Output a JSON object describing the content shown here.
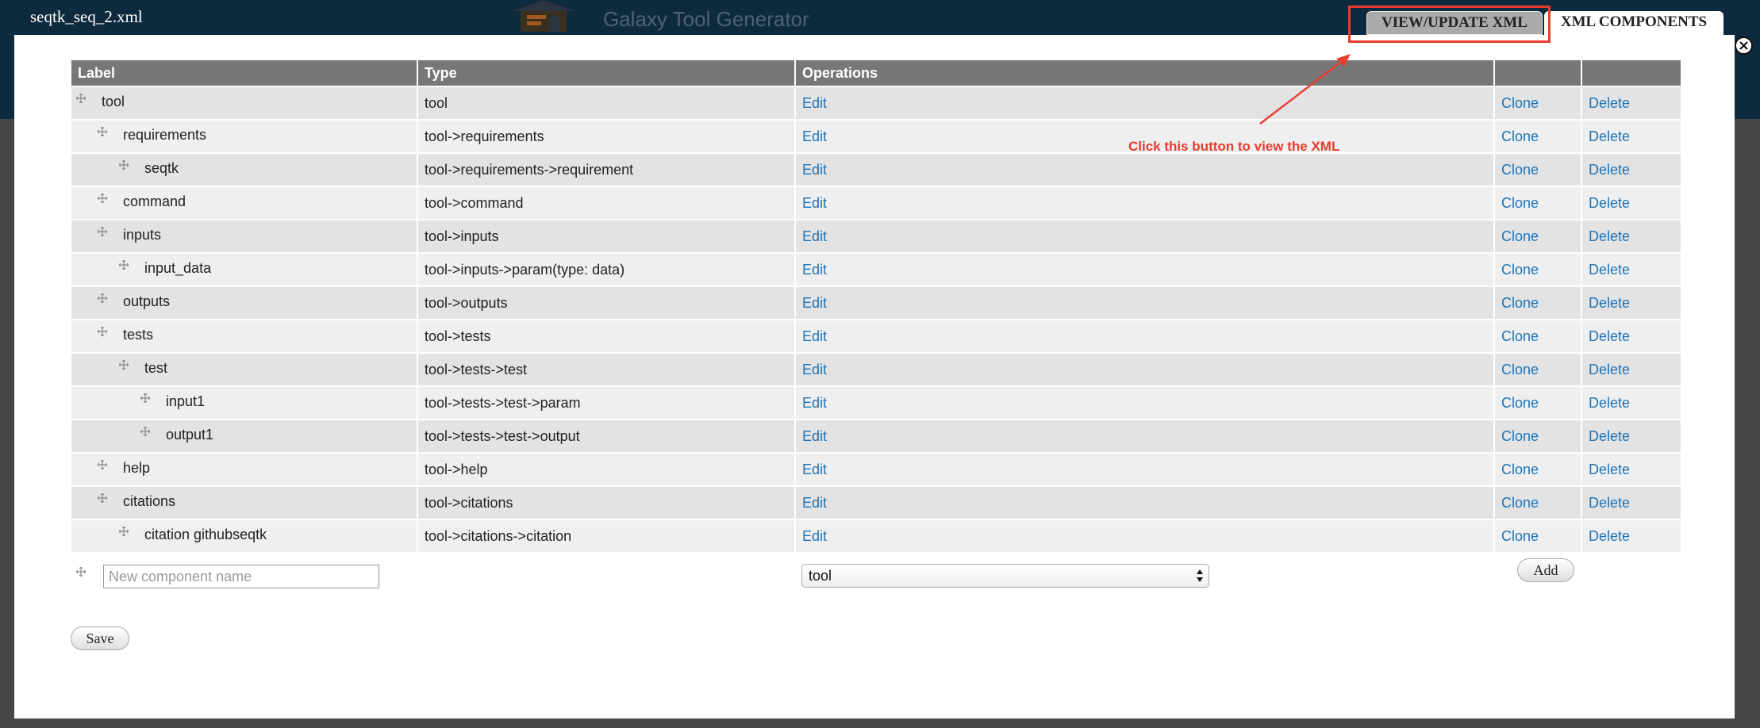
{
  "header": {
    "dialog_title": "seqtk_seq_2.xml",
    "brand_title": "Galaxy Tool Generator",
    "close_icon": "close-icon"
  },
  "tabs": [
    {
      "label": "VIEW/UPDATE XML"
    },
    {
      "label": "XML COMPONENTS"
    }
  ],
  "table": {
    "columns": [
      "Label",
      "Type",
      "Operations"
    ],
    "rows": [
      {
        "label": "tool",
        "type": "tool",
        "depth": 0
      },
      {
        "label": "requirements",
        "type": "tool->requirements",
        "depth": 1
      },
      {
        "label": "seqtk",
        "type": "tool->requirements->requirement",
        "depth": 2
      },
      {
        "label": "command",
        "type": "tool->command",
        "depth": 1
      },
      {
        "label": "inputs",
        "type": "tool->inputs",
        "depth": 1
      },
      {
        "label": "input_data",
        "type": "tool->inputs->param(type: data)",
        "depth": 2
      },
      {
        "label": "outputs",
        "type": "tool->outputs",
        "depth": 1
      },
      {
        "label": "tests",
        "type": "tool->tests",
        "depth": 1
      },
      {
        "label": "test",
        "type": "tool->tests->test",
        "depth": 2
      },
      {
        "label": "input1",
        "type": "tool->tests->test->param",
        "depth": 3
      },
      {
        "label": "output1",
        "type": "tool->tests->test->output",
        "depth": 3
      },
      {
        "label": "help",
        "type": "tool->help",
        "depth": 1
      },
      {
        "label": "citations",
        "type": "tool->citations",
        "depth": 1
      },
      {
        "label": "citation githubseqtk",
        "type": "tool->citations->citation",
        "depth": 2
      }
    ],
    "ops": {
      "edit": "Edit",
      "clone": "Clone",
      "delete": "Delete"
    }
  },
  "new_component": {
    "placeholder": "New component name",
    "type_selected": "tool",
    "add_label": "Add"
  },
  "save_label": "Save",
  "annotation": "Click this button to view the XML",
  "colors": {
    "topbar": "#0e2a3e",
    "link": "#1f73b7",
    "annotation": "#e93c2e",
    "header_row": "#777777"
  }
}
